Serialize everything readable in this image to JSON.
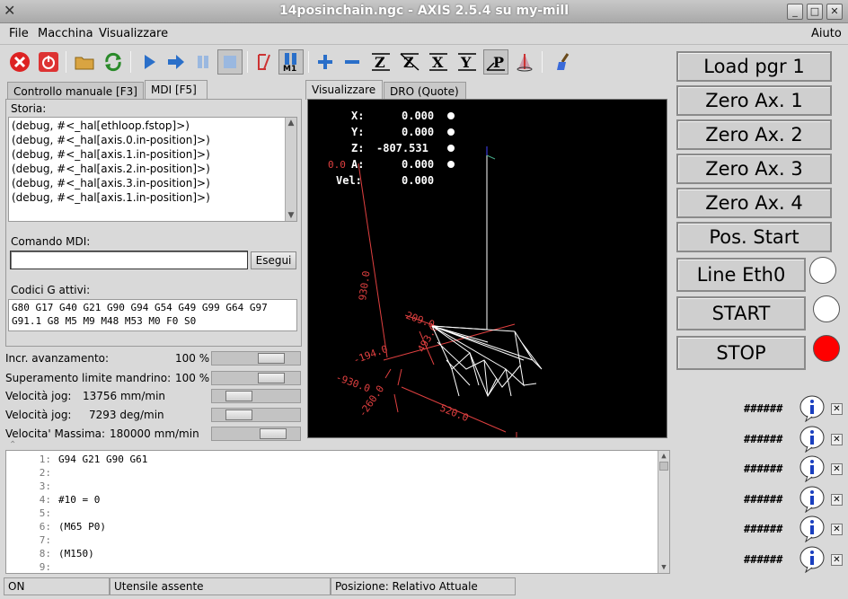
{
  "window": {
    "title": "14posinchain.ngc - AXIS 2.5.4 su my-mill"
  },
  "menubar": {
    "file": "File",
    "machine": "Macchina",
    "view": "Visualizzare",
    "help": "Aiuto"
  },
  "toolbar": {
    "icons": [
      "estop-icon",
      "power-icon",
      "open-file-icon",
      "reload-icon",
      "run-icon",
      "step-icon",
      "pause-icon",
      "stop-icon",
      "block-delete-icon",
      "optional-stop-icon",
      "zoom-in-icon",
      "zoom-out-icon",
      "view-z-icon",
      "view-z2-icon",
      "view-x-icon",
      "view-y-icon",
      "view-p-icon",
      "rotate-icon",
      "clear-plot-icon"
    ],
    "m1_label": "M1",
    "z_label": "Z",
    "x_label": "X",
    "y_label": "Y",
    "p_label": "P"
  },
  "left_tabs": {
    "manual": "Controllo manuale [F3]",
    "mdi": "MDI [F5]"
  },
  "mdi": {
    "history_label": "Storia:",
    "history": [
      "(debug, #<_hal[ethloop.fstop]>)",
      "(debug, #<_hal[axis.0.in-position]>)",
      "(debug, #<_hal[axis.1.in-position]>)",
      "(debug, #<_hal[axis.2.in-position]>)",
      "(debug, #<_hal[axis.3.in-position]>)",
      "(debug, #<_hal[axis.1.in-position]>)"
    ],
    "command_label": "Comando MDI:",
    "command_value": "",
    "run_button": "Esegui",
    "gcodes_label": "Codici G attivi:",
    "gcodes_line1": "G80 G17 G40 G21 G90 G94 G54 G49 G99 G64 G97",
    "gcodes_line2": "G91.1 G8 M5 M9 M48 M53 M0 F0 S0"
  },
  "overrides": {
    "feed_label": "Incr. avanzamento:",
    "feed_value": "100 %",
    "feed_fraction": 0.75,
    "spindle_label": "Superamento limite mandrino:",
    "spindle_value": "100 %",
    "spindle_fraction": 0.75,
    "jog_label": "Velocità jog:",
    "jog_value": "13756 mm/min",
    "jog_fraction": 0.22,
    "jog_ang_label": "Velocità jog:",
    "jog_ang_value": "7293 deg/min",
    "jog_ang_fraction": 0.22,
    "max_label": "Velocita' Massima:",
    "max_value": "180000 mm/min",
    "max_fraction": 0.78
  },
  "preview_tabs": {
    "preview": "Visualizzare",
    "dro": "DRO (Quote)"
  },
  "dro": {
    "x_label": "X:",
    "x_value": "0.000",
    "y_label": "Y:",
    "y_value": "0.000",
    "z_label": "Z:",
    "z_value": "-807.531",
    "a_label": "A:",
    "a_value": "0.000",
    "vel_label": "Vel:",
    "vel_value": "0.000"
  },
  "plot_labels": {
    "origin": "0.0",
    "dim_930": "930.0",
    "dim_209": "209.0",
    "dim_493": "493.0",
    "dim_194": "-194.0",
    "dim_930n": "-930.0",
    "dim_260": "-260.0",
    "dim_520": "520.0"
  },
  "editor": {
    "lines": [
      {
        "n": "1:",
        "t": "G94 G21 G90 G61"
      },
      {
        "n": "2:",
        "t": ""
      },
      {
        "n": "3:",
        "t": ""
      },
      {
        "n": "4:",
        "t": "#10 = 0"
      },
      {
        "n": "5:",
        "t": ""
      },
      {
        "n": "6:",
        "t": "(M65 P0)"
      },
      {
        "n": "7:",
        "t": ""
      },
      {
        "n": "8:",
        "t": "(M150)"
      },
      {
        "n": "9:",
        "t": ""
      }
    ]
  },
  "statusbar": {
    "state": "ON",
    "tool": "Utensile assente",
    "position": "Posizione: Relativo Attuale"
  },
  "right_panel": {
    "load": "Load pgr 1",
    "zero1": "Zero Ax. 1",
    "zero2": "Zero Ax. 2",
    "zero3": "Zero Ax. 3",
    "zero4": "Zero Ax. 4",
    "pos_start": "Pos. Start",
    "line_eth": "Line Eth0",
    "start": "START",
    "stop": "STOP",
    "led_off_color": "#ffffff",
    "led_on_color": "#ff0000",
    "messages": [
      "######",
      "######",
      "######",
      "######",
      "######",
      "######"
    ]
  }
}
